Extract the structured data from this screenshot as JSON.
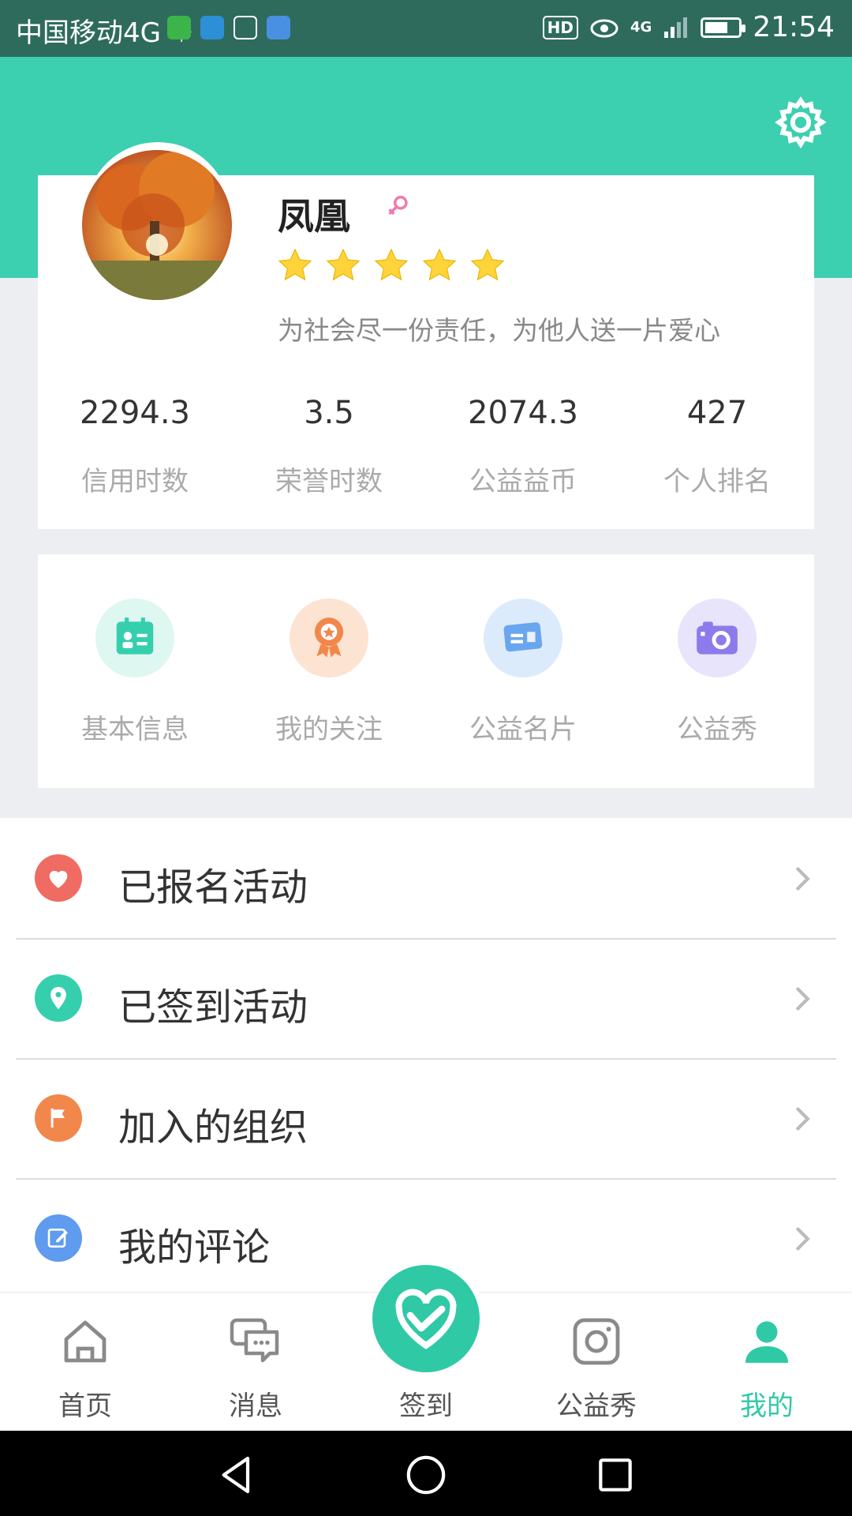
{
  "status_bar": {
    "carrier": "中国移动4G ☼",
    "hd": "HD",
    "network": "4G",
    "time": "21:54"
  },
  "profile": {
    "name": "凤凰",
    "gender_icon": "female-icon",
    "stars": 5,
    "motto": "为社会尽一份责任，为他人送一片爱心"
  },
  "stats": [
    {
      "value": "2294.3",
      "label": "信用时数"
    },
    {
      "value": "3.5",
      "label": "荣誉时数"
    },
    {
      "value": "2074.3",
      "label": "公益益币"
    },
    {
      "value": "427",
      "label": "个人排名"
    }
  ],
  "quick_actions": [
    {
      "label": "基本信息",
      "icon": "id-card-icon",
      "bg": "#dff7f1",
      "color": "#35cfae"
    },
    {
      "label": "我的关注",
      "icon": "medal-icon",
      "bg": "#fde3d2",
      "color": "#f2874c"
    },
    {
      "label": "公益名片",
      "icon": "business-card-icon",
      "bg": "#dcebfb",
      "color": "#6aa6ee"
    },
    {
      "label": "公益秀",
      "icon": "camera-icon",
      "bg": "#e8e4fb",
      "color": "#8d7bec"
    }
  ],
  "menu": [
    {
      "label": "已报名活动",
      "icon": "heart-icon",
      "color": "#f06b62"
    },
    {
      "label": "已签到活动",
      "icon": "location-pin-icon",
      "color": "#35cfae"
    },
    {
      "label": "加入的组织",
      "icon": "flag-icon",
      "color": "#f2874c"
    },
    {
      "label": "我的评论",
      "icon": "edit-icon",
      "color": "#5f9bee"
    }
  ],
  "bottom_nav": [
    {
      "label": "首页",
      "icon": "home-icon"
    },
    {
      "label": "消息",
      "icon": "chat-icon"
    },
    {
      "label": "签到",
      "icon": "heart-hand-icon"
    },
    {
      "label": "公益秀",
      "icon": "instagram-icon"
    },
    {
      "label": "我的",
      "icon": "user-icon"
    }
  ],
  "colors": {
    "accent": "#2fc9a6",
    "header": "#3ccfb0",
    "status_bar": "#2e6b5c"
  }
}
